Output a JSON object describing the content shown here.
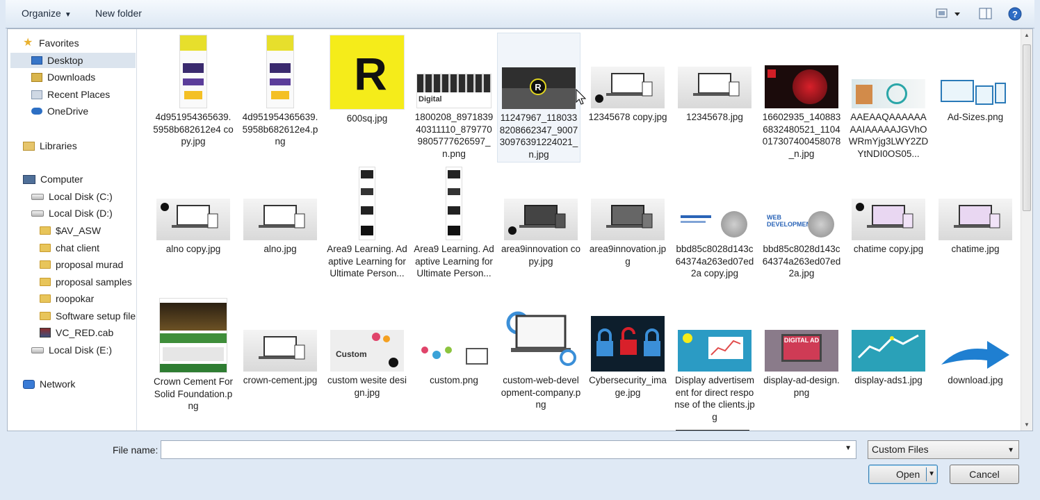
{
  "toolbar": {
    "organize": "Organize",
    "new_folder": "New folder"
  },
  "nav": {
    "favorites": "Favorites",
    "desktop": "Desktop",
    "downloads": "Downloads",
    "recent": "Recent Places",
    "onedrive": "OneDrive",
    "libraries": "Libraries",
    "computer": "Computer",
    "disk_c": "Local Disk (C:)",
    "disk_d": "Local Disk (D:)",
    "folders": [
      "$AV_ASW",
      "chat client",
      "proposal murad",
      "proposal samples",
      "roopokar",
      "Software setup file"
    ],
    "cab": "VC_RED.cab",
    "disk_e": "Local Disk (E:)",
    "network": "Network"
  },
  "files": [
    "4d951954365639.5958b682612e4 copy.jpg",
    "4d951954365639.5958b682612e4.png",
    "600sq.jpg",
    "1800208_897183940311110_8797709805777626597_n.png",
    "11247967_1180338208662347_900730976391224021_n.jpg",
    "12345678 copy.jpg",
    "12345678.jpg",
    "16602935_1408836832480521_1104017307400458078_n.jpg",
    "AAEAAQAAAAAAAAIAAAAAJGVhOWRmYjg3LWY2ZDYtNDI0OS05...",
    "Ad-Sizes.png",
    "alno copy.jpg",
    "alno.jpg",
    "Area9 Learning. Adaptive Learning for Ultimate Person...",
    "Area9 Learning. Adaptive Learning for Ultimate Person...",
    "area9innovation copy.jpg",
    "area9innovation.jpg",
    "bbd85c8028d143c64374a263ed07ed2a copy.jpg",
    "bbd85c8028d143c64374a263ed07ed2a.jpg",
    "chatime copy.jpg",
    "chatime.jpg",
    "Crown Cement For Solid Foundation.png",
    "crown-cement.jpg",
    "custom wesite design.jpg",
    "custom.png",
    "custom-web-development-company.png",
    "Cybersecurity_image.jpg",
    "Display advertisement for direct response of the clients.jpg",
    "display-ad-design.png",
    "display-ads1.jpg",
    "download.jpg"
  ],
  "thumb_texts": {
    "roopokar": "R",
    "digital": "Digital",
    "custom": "Custom",
    "web_dev": "WEB DEVELOPMENT",
    "digital_ad": "DIGITAL AD"
  },
  "bottom": {
    "file_name_label": "File name:",
    "file_name_value": "",
    "filter": "Custom Files",
    "open": "Open",
    "cancel": "Cancel"
  },
  "colors": {
    "selection": "#dbe4ee",
    "accent": "#3c7fb1",
    "yellow": "#f5ec1a"
  }
}
